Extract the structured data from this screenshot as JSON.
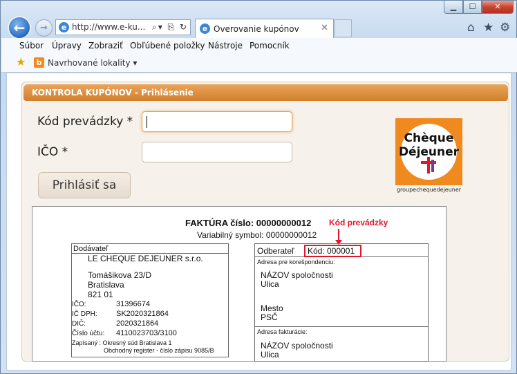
{
  "browser": {
    "address": "http://www.e-ku...",
    "tab_title": "Overovanie kupónov",
    "menu": [
      "Súbor",
      "Úpravy",
      "Zobraziť",
      "Obľúbené položky",
      "Nástroje",
      "Pomocník"
    ],
    "favorites_label": "Navrhované lokality ▾"
  },
  "page": {
    "header": "KONTROLA KUPÓNOV - Prihlásenie",
    "fields": {
      "kod_label": "Kód prevádzky *",
      "ico_label": "IČO *"
    },
    "login_button": "Prihlásiť sa",
    "logo": {
      "line1": "Chèque",
      "line2": "Déjeuner",
      "sub": "groupechequedejeuner"
    }
  },
  "invoice": {
    "title": "FAKTÚRA  číslo:  00000000012",
    "variable_symbol": "Variabilný symbol: 00000000012",
    "highlight": "Kód prevádzky",
    "supplier_label": "Dodávateľ",
    "supplier_name": "LE CHEQUE DEJEUNER  s.r.o.",
    "supplier_street": "Tomášikova 23/D",
    "supplier_city": "Bratislava",
    "supplier_zip": "821 01",
    "ico_k": "IČO:",
    "ico_v": "31396674",
    "icdph_k": "IČ DPH:",
    "icdph_v": "SK2020321864",
    "dic_k": "DIČ:",
    "dic_v": "2020321864",
    "ucet_k": "Číslo účtu:",
    "ucet_v": "4110023703/3100",
    "zapis1": "Zapísaný :  Okresný súd Bratislava 1",
    "zapis2": "Obchodný register - číslo zápisu 9085/B",
    "customer_label": "Odberateľ",
    "kod": "Kód:  000001",
    "corr_label": "Adresa pre korešpondenciu:",
    "company": "NÁZOV spoločnosti",
    "street": "Ulica",
    "town": "Mesto",
    "psc": "PSČ",
    "bill_label": "Adresa fakturácie:",
    "company2": "NÁZOV spoločnosti",
    "street2": "Ulica"
  }
}
